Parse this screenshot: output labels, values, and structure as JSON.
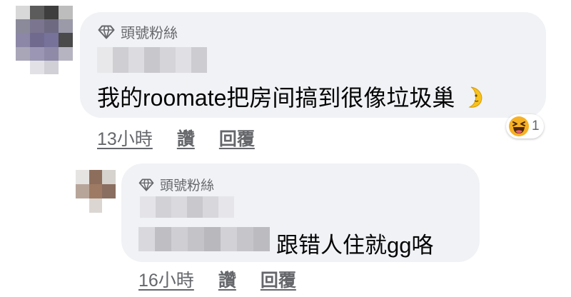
{
  "comments": [
    {
      "badge_label": "頭號粉絲",
      "author_name": "",
      "text": "我的roomate把房间搞到很像垃圾巢",
      "text_emoji": "moon-face-icon",
      "reaction": {
        "emoji": "laughing-face-icon",
        "count": "1"
      },
      "timestamp": "13小時",
      "like_label": "讚",
      "reply_label": "回覆"
    },
    {
      "badge_label": "頭號粉絲",
      "author_name": "",
      "text": "跟错人住就gg咯",
      "timestamp": "16小時",
      "like_label": "讚",
      "reply_label": "回覆"
    }
  ],
  "colors": {
    "bubble": "#f0f2f5",
    "secondary_text": "#65676b",
    "primary_text": "#050505",
    "reaction_yellow": "#f7b125"
  }
}
